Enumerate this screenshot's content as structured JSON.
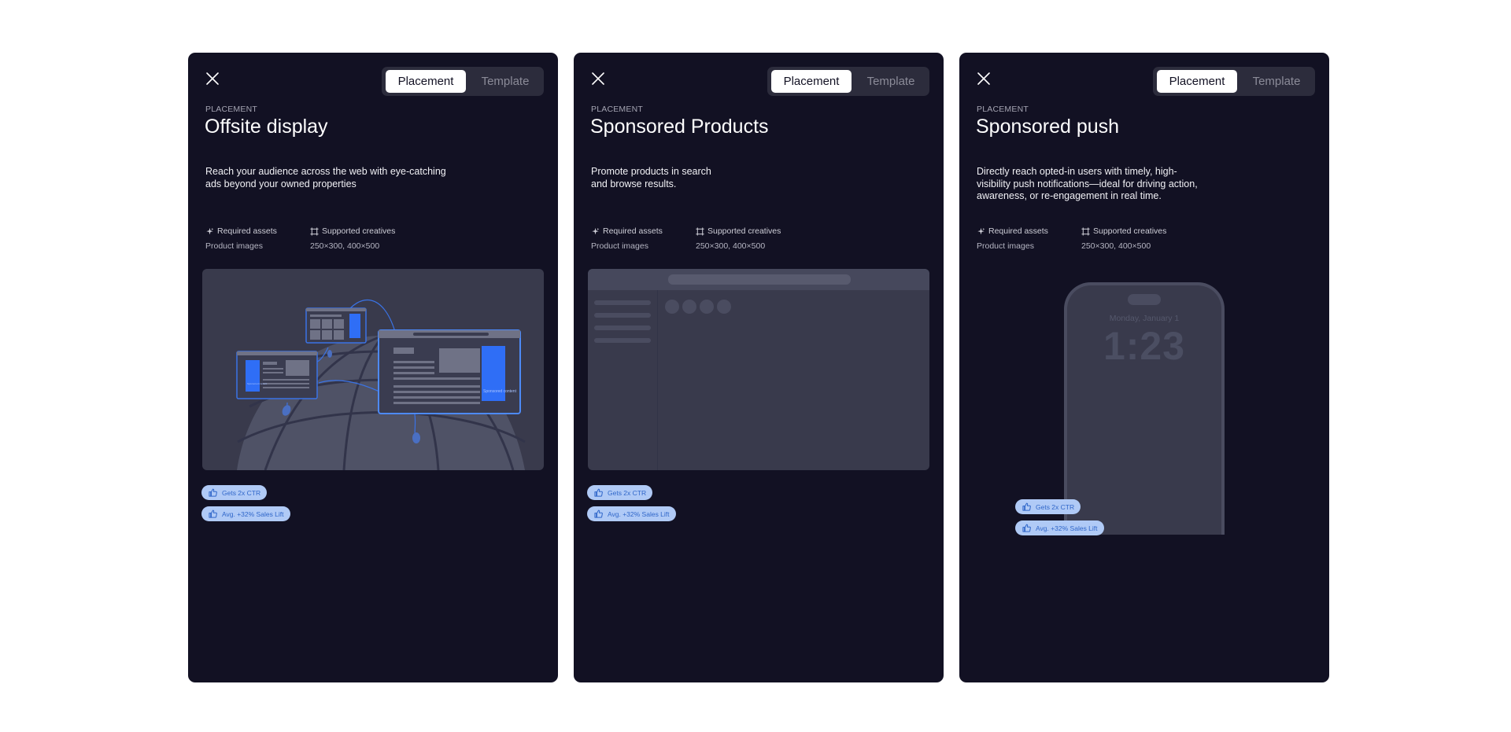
{
  "tabs": {
    "placement": "Placement",
    "template": "Template"
  },
  "cards": [
    {
      "eyebrow": "PLACEMENT",
      "title": "Offsite display",
      "description": "Reach your audience across the web with eye-catching\nads beyond your owned properties",
      "required_assets_label": "Required assets",
      "required_assets_value": "Product images",
      "supported_creatives_label": "Supported creatives",
      "supported_creatives_value": "250×300, 400×500",
      "illustration_text": [
        "Sponsored content",
        "Sponsored content"
      ],
      "badges": [
        "Gets 2x CTR",
        "Avg. +32% Sales Lift"
      ]
    },
    {
      "eyebrow": "PLACEMENT",
      "title": "Sponsored Products",
      "description": "Promote products in search\nand browse results.",
      "required_assets_label": "Required assets",
      "required_assets_value": "Product images",
      "supported_creatives_label": "Supported creatives",
      "supported_creatives_value": "250×300, 400×500",
      "badges": [
        "Gets 2x CTR",
        "Avg. +32% Sales Lift"
      ]
    },
    {
      "eyebrow": "PLACEMENT",
      "title": "Sponsored push",
      "description": "Directly reach opted-in users with timely, high-\nvisibility push notifications—ideal for driving action,\nawareness, or re-engagement in real time.",
      "required_assets_label": "Required assets",
      "required_assets_value": "Product images",
      "supported_creatives_label": "Supported creatives",
      "supported_creatives_value": "250×300, 400×500",
      "phone_date": "Monday, January 1",
      "phone_time": "1:23",
      "badges": [
        "Gets 2x CTR",
        "Avg. +32% Sales Lift"
      ]
    }
  ],
  "colors": {
    "card_bg": "#121123",
    "accent": "#2f6ef6",
    "badge_bg": "#b0caf6",
    "badge_text": "#2f66c9"
  }
}
